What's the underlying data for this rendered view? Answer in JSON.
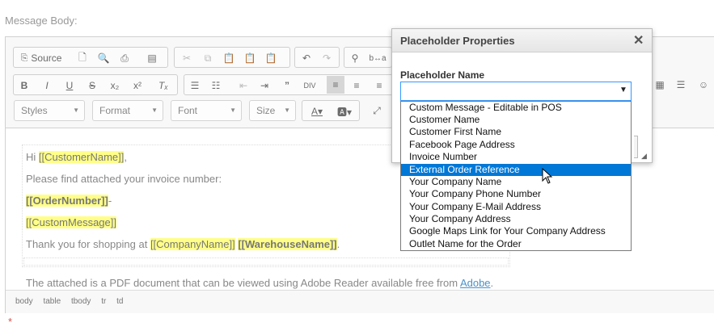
{
  "page": {
    "message_body_label": "Message Body:",
    "required_mark": "*"
  },
  "toolbar": {
    "source_label": "Source",
    "styles_label": "Styles",
    "format_label": "Format",
    "font_label": "Font",
    "size_label": "Size"
  },
  "content": {
    "line1_prefix": "Hi ",
    "line1_ph": "[[CustomerName]]",
    "line1_suffix": ",",
    "line2": "Please find attached your invoice number:",
    "line3_ph": "[[OrderNumber]]",
    "line3_suffix": "-",
    "line4_ph": "[[CustomMessage]]",
    "line5_prefix": "Thank you for shopping at ",
    "line5_ph1": "[[CompanyName]]",
    "line5_ph2": "[[WarehouseName]]",
    "line5_suffix": ".",
    "line6_text": "The attached is a PDF document that can be viewed using Adobe Reader available free from ",
    "line6_link": "Adobe",
    "line6_suffix": "."
  },
  "statusbar": {
    "path": [
      "body",
      "table",
      "tbody",
      "tr",
      "td"
    ]
  },
  "dialog": {
    "title": "Placeholder Properties",
    "close_glyph": "✕",
    "field_label": "Placeholder Name",
    "selected_value": ""
  },
  "dropdown": {
    "options": [
      "Custom Message - Editable in POS",
      "Customer Name",
      "Customer First Name",
      "Facebook Page Address",
      "Invoice Number",
      "External Order Reference",
      "Your Company Name",
      "Your Company Phone Number",
      "Your Company E-Mail Address",
      "Your Company Address",
      "Google Maps Link for Your Company Address",
      "Outlet Name for the Order"
    ],
    "highlighted_index": 5,
    "highlight_color": "#0078d7"
  }
}
